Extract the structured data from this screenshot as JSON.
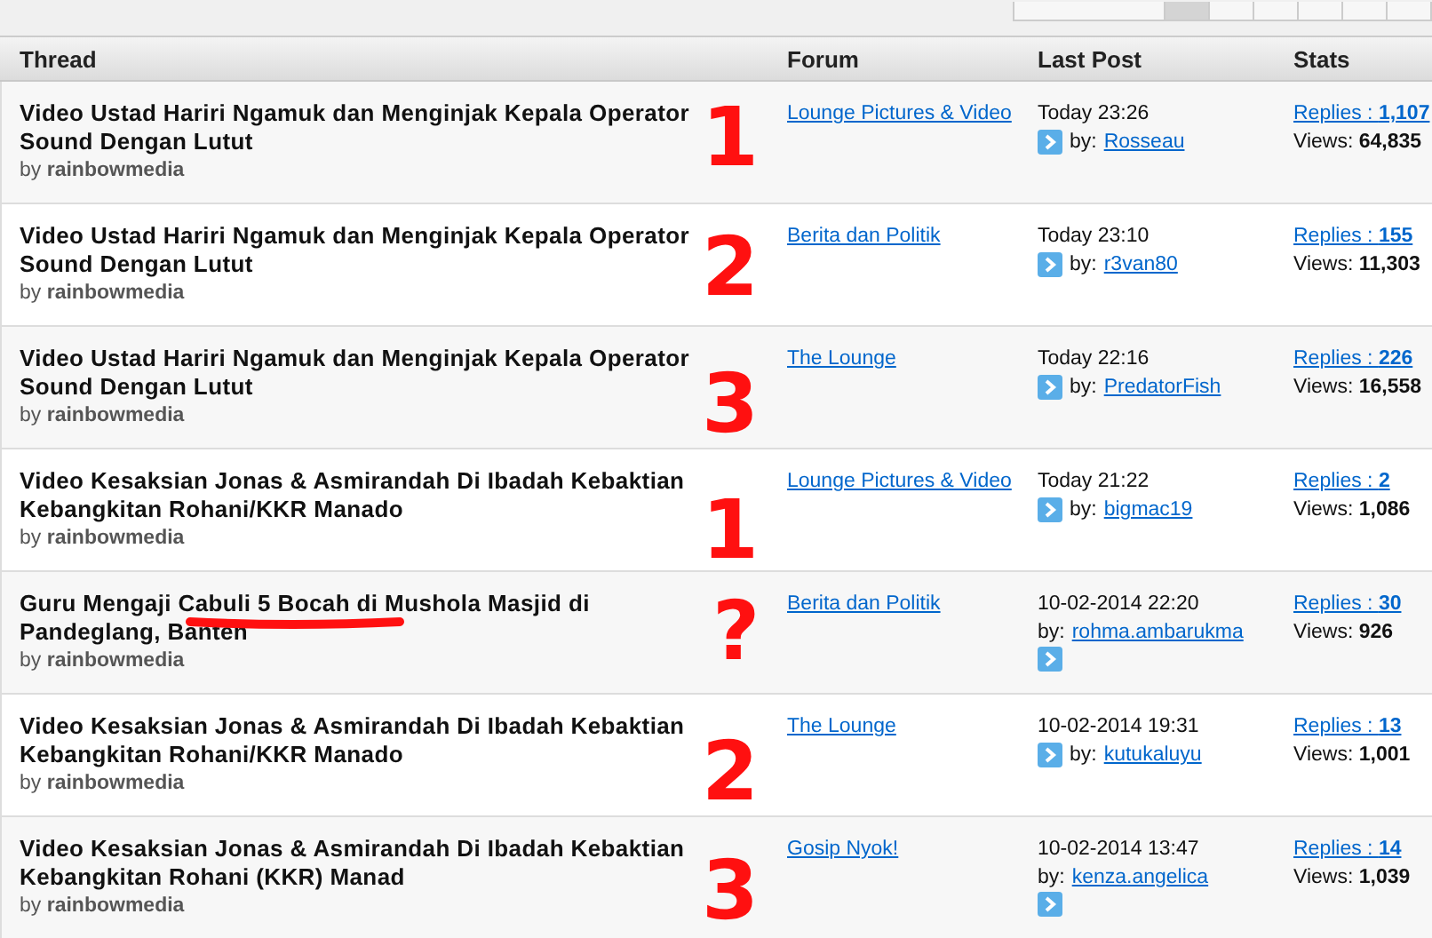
{
  "pager": {
    "pages": [
      {
        "selected": true
      },
      {
        "selected": false
      },
      {
        "selected": false
      },
      {
        "selected": false
      },
      {
        "selected": false
      },
      {
        "selected": false
      }
    ]
  },
  "columns": [
    "Thread",
    "Forum",
    "Last Post",
    "Stats"
  ],
  "rows": [
    {
      "title": "Video Ustad Hariri Ngamuk dan Menginjak Kepala Operator Sound Dengan Lutut",
      "by": "by",
      "author": "rainbowmedia",
      "forum": "Lounge Pictures & Video",
      "time": "Today 23:26",
      "by_label": "by:",
      "poster": "Rosseau",
      "replies_label": "Replies : ",
      "replies": "1,107",
      "views_label": "Views:",
      "views": "64,835",
      "mark": "1",
      "underlined": false
    },
    {
      "title": "Video Ustad Hariri Ngamuk dan Menginjak Kepala Operator Sound Dengan Lutut",
      "by": "by",
      "author": "rainbowmedia",
      "forum": "Berita dan Politik",
      "time": "Today 23:10",
      "by_label": "by:",
      "poster": "r3van80",
      "replies_label": "Replies : ",
      "replies": "155",
      "views_label": "Views:",
      "views": "11,303",
      "mark": "2",
      "underlined": false
    },
    {
      "title": "Video Ustad Hariri Ngamuk dan Menginjak Kepala Operator Sound Dengan Lutut",
      "by": "by",
      "author": "rainbowmedia",
      "forum": "The Lounge",
      "time": "Today 22:16",
      "by_label": "by:",
      "poster": "PredatorFish",
      "replies_label": "Replies : ",
      "replies": "226",
      "views_label": "Views:",
      "views": "16,558",
      "mark": "3",
      "underlined": false
    },
    {
      "title": "Video Kesaksian Jonas & Asmirandah Di Ibadah Kebaktian Kebangkitan Rohani/KKR Manado",
      "by": "by",
      "author": "rainbowmedia",
      "forum": "Lounge Pictures & Video",
      "time": "Today 21:22",
      "by_label": "by:",
      "poster": "bigmac19",
      "replies_label": "Replies : ",
      "replies": "2",
      "views_label": "Views:",
      "views": "1,086",
      "mark": "1",
      "underlined": false
    },
    {
      "title": "Guru Mengaji Cabuli 5 Bocah di Mushola Masjid di Pandeglang, Banten",
      "by": "by",
      "author": "rainbowmedia",
      "forum": "Berita dan Politik",
      "time": "10-02-2014 22:20",
      "by_label": "by:",
      "poster": "rohma.ambarukma",
      "replies_label": "Replies : ",
      "replies": "30",
      "views_label": "Views:",
      "views": "926",
      "mark": "?",
      "underlined": true
    },
    {
      "title": "Video Kesaksian Jonas & Asmirandah Di Ibadah Kebaktian Kebangkitan Rohani/KKR Manado",
      "by": "by",
      "author": "rainbowmedia",
      "forum": "The Lounge",
      "time": "10-02-2014 19:31",
      "by_label": "by:",
      "poster": "kutukaluyu",
      "replies_label": "Replies : ",
      "replies": "13",
      "views_label": "Views:",
      "views": "1,001",
      "mark": "2",
      "underlined": false
    },
    {
      "title": "Video Kesaksian Jonas & Asmirandah Di Ibadah Kebaktian Kebangkitan Rohani (KKR) Manad",
      "by": "by",
      "author": "rainbowmedia",
      "forum": "Gosip Nyok!",
      "time": "10-02-2014 13:47",
      "by_label": "by:",
      "poster": "kenza.angelica",
      "replies_label": "Replies : ",
      "replies": "14",
      "views_label": "Views:",
      "views": "1,039",
      "mark": "3",
      "underlined": false
    }
  ]
}
